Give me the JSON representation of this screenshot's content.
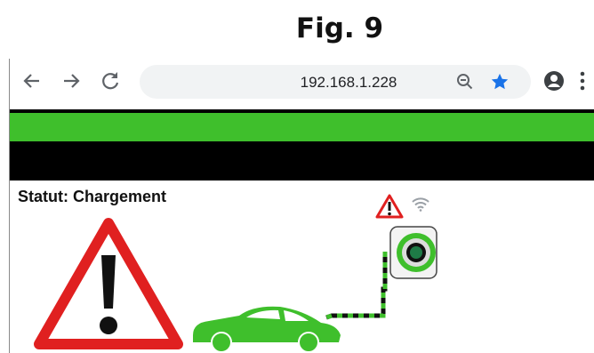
{
  "figure_caption": "Fig. 9",
  "browser": {
    "url": "192.168.1.228",
    "icons": [
      "back-arrow-icon",
      "forward-arrow-icon",
      "reload-icon",
      "zoom-out-icon",
      "bookmark-star-icon",
      "account-icon",
      "menu-dots-icon"
    ],
    "bookmark_color": "#1a73e8"
  },
  "page": {
    "header_color": "#3fbf2c",
    "subheader_color": "#000000",
    "status_text": "Statut: Chargement",
    "warning_color": "#e02020",
    "car_color": "#3fbf2c"
  }
}
